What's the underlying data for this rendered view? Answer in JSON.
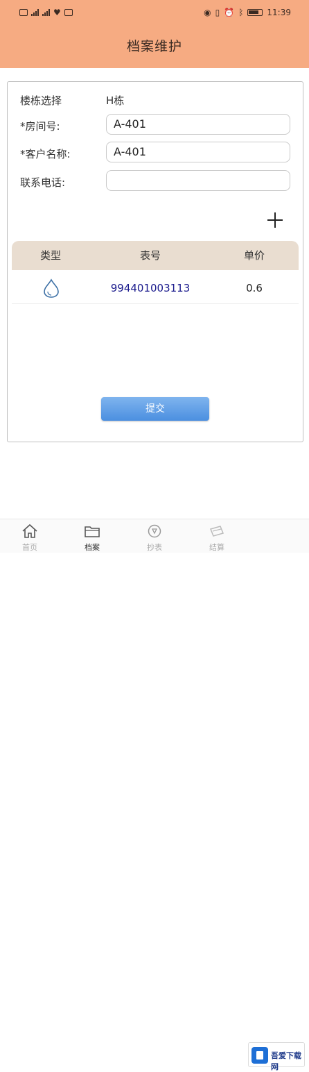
{
  "status_bar": {
    "time": "11:39"
  },
  "header": {
    "title": "档案维护"
  },
  "form": {
    "building_label": "楼栋选择",
    "building_value": "H栋",
    "room_label": "*房间号:",
    "room_value": "A-401",
    "customer_label": "*客户名称:",
    "customer_value": "A-401",
    "phone_label": "联系电话:",
    "phone_value": ""
  },
  "table": {
    "headers": [
      "类型",
      "表号",
      "单价"
    ],
    "rows": [
      {
        "type_icon": "water-drop-icon",
        "meter_no": "994401003113",
        "price": "0.6"
      }
    ]
  },
  "submit_label": "提交",
  "tabbar": {
    "items": [
      {
        "label": "首页",
        "icon": "home-icon",
        "active": false
      },
      {
        "label": "档案",
        "icon": "folder-icon",
        "active": true
      },
      {
        "label": "抄表",
        "icon": "meter-icon",
        "active": false
      },
      {
        "label": "结算",
        "icon": "cash-icon",
        "active": false
      }
    ]
  },
  "watermark": {
    "text": "吾爱下载网"
  },
  "colors": {
    "header_bg": "#f6ab82",
    "table_header_bg": "#e9ddd0",
    "meter_text": "#1a1a8c",
    "button": "#4b8fe0"
  }
}
